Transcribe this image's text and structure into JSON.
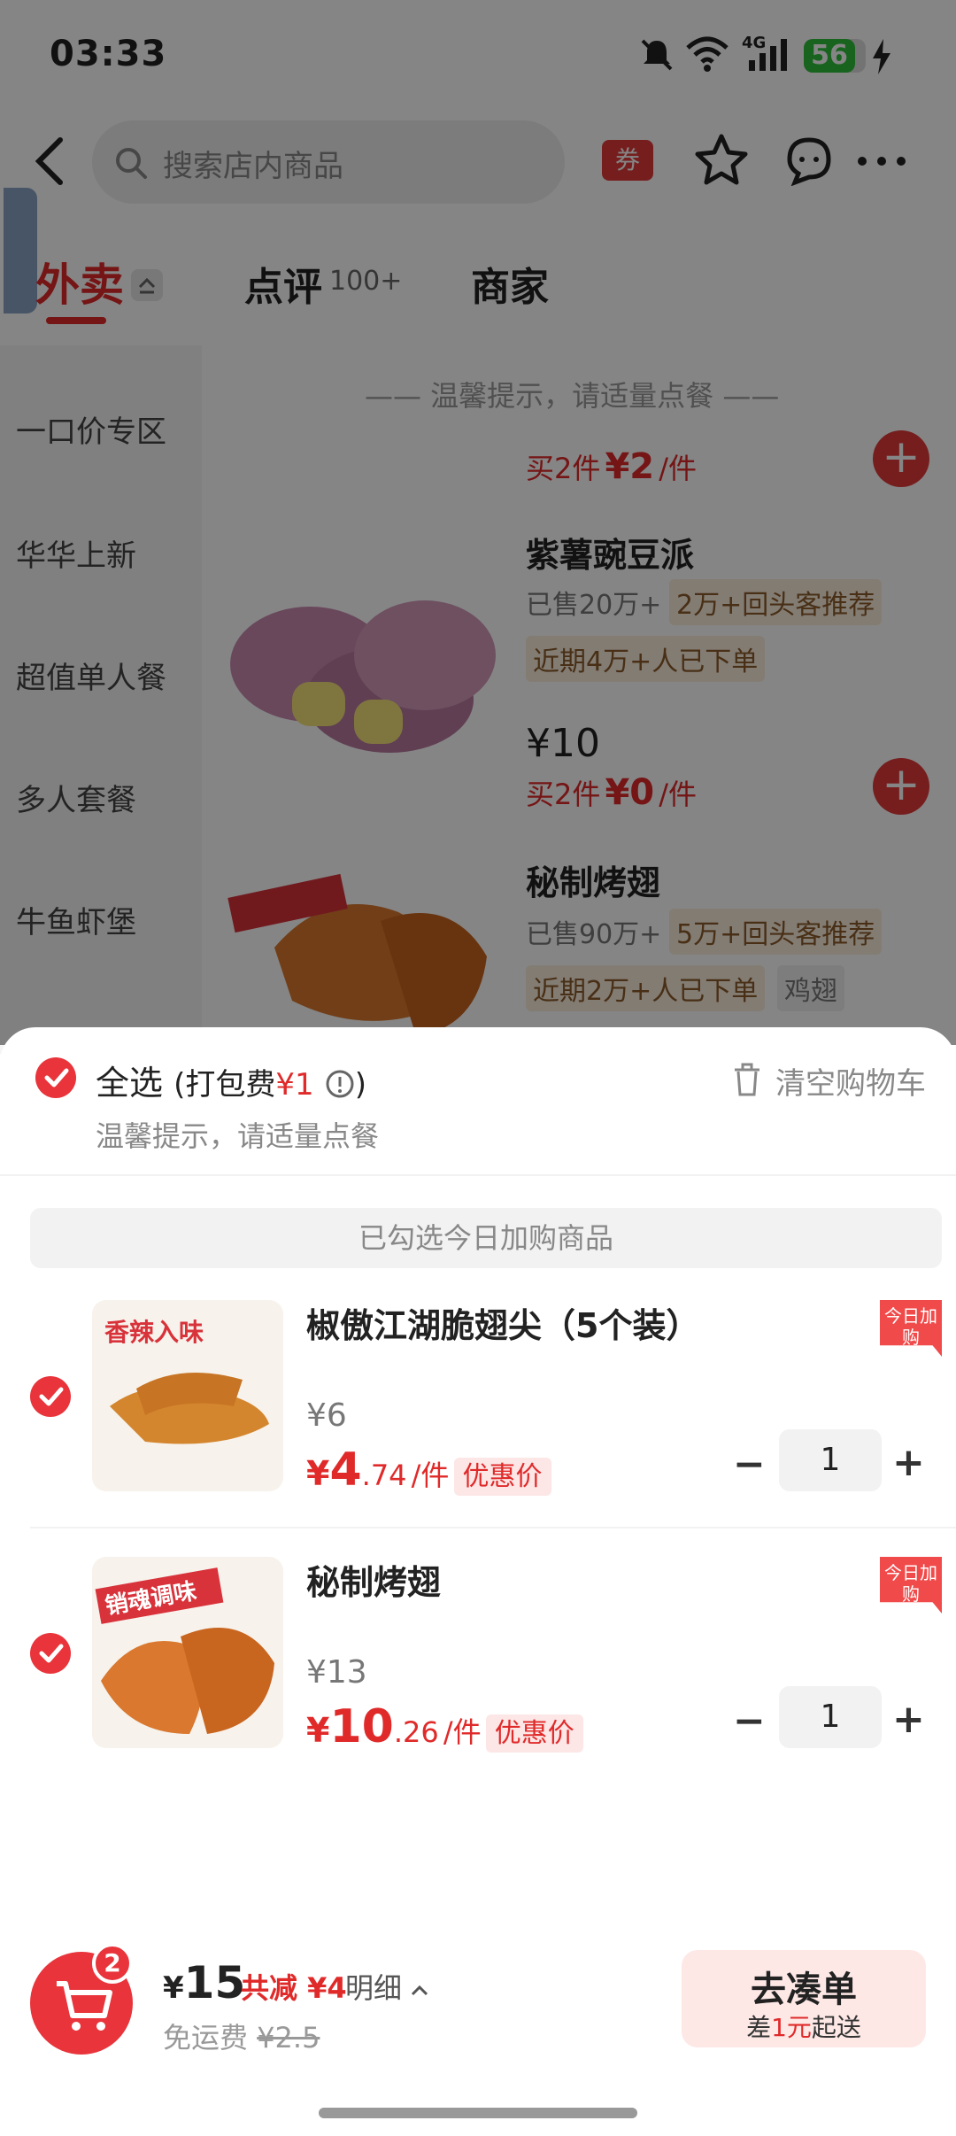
{
  "status_bar": {
    "time": "03:33",
    "battery": "56",
    "network": "4G"
  },
  "header": {
    "search_placeholder": "搜索店内商品",
    "coupon": "券"
  },
  "tabs": {
    "waimai": "外卖",
    "pinglun": "点评",
    "pinglun_count": "100+",
    "shangjia": "商家"
  },
  "sidebar": {
    "items": [
      "一口价专区",
      "华华上新",
      "超值单人餐",
      "多人套餐",
      "牛鱼虾堡"
    ]
  },
  "menu": {
    "tip": "—— 温馨提示，请适量点餐 ——",
    "prev_promo": "买2件",
    "prev_promo_price": "¥2",
    "prev_promo_unit": "/件",
    "products": [
      {
        "name": "紫薯豌豆派",
        "sold": "已售20万+",
        "tag1": "2万+回头客推荐",
        "tag2": "近期4万+人已下单",
        "price": "¥10",
        "promo": "买2件",
        "promo_price": "¥0",
        "promo_unit": "/件"
      },
      {
        "name": "秘制烤翅",
        "sold": "已售90万+",
        "tag1": "5万+回头客推荐",
        "tag2": "近期2万+人已下单",
        "tag3": "鸡翅"
      }
    ]
  },
  "cart": {
    "select_all": "全选",
    "packing_fee_prefix": "(打包费",
    "packing_fee": "¥1",
    "packing_fee_suffix": ")",
    "tip": "温馨提示，请适量点餐",
    "clear": "清空购物车",
    "banner": "已勾选今日加购商品",
    "items": [
      {
        "name": "椒傲江湖脆翅尖（5个装）",
        "orig_price": "¥6",
        "sale_yen": "¥",
        "sale_int": "4",
        "sale_dec": ".74",
        "unit": "/件",
        "badge": "优惠价",
        "corner": "今日加购",
        "qty": "1",
        "img_label": "香辣入味"
      },
      {
        "name": "秘制烤翅",
        "orig_price": "¥13",
        "sale_yen": "¥",
        "sale_int": "10",
        "sale_dec": ".26",
        "unit": "/件",
        "badge": "优惠价",
        "corner": "今日加购",
        "qty": "1",
        "img_label": "销魂调味"
      }
    ]
  },
  "bottom_bar": {
    "cart_count": "2",
    "total_yen": "¥",
    "total": "15",
    "reduce": "共减 ¥4",
    "detail": "明细",
    "free_ship": "免运费",
    "ship_orig": "¥2.5",
    "go_label": "去凑单",
    "go_sub_prefix": "差",
    "go_sub_amount": "1元",
    "go_sub_suffix": "起送"
  }
}
